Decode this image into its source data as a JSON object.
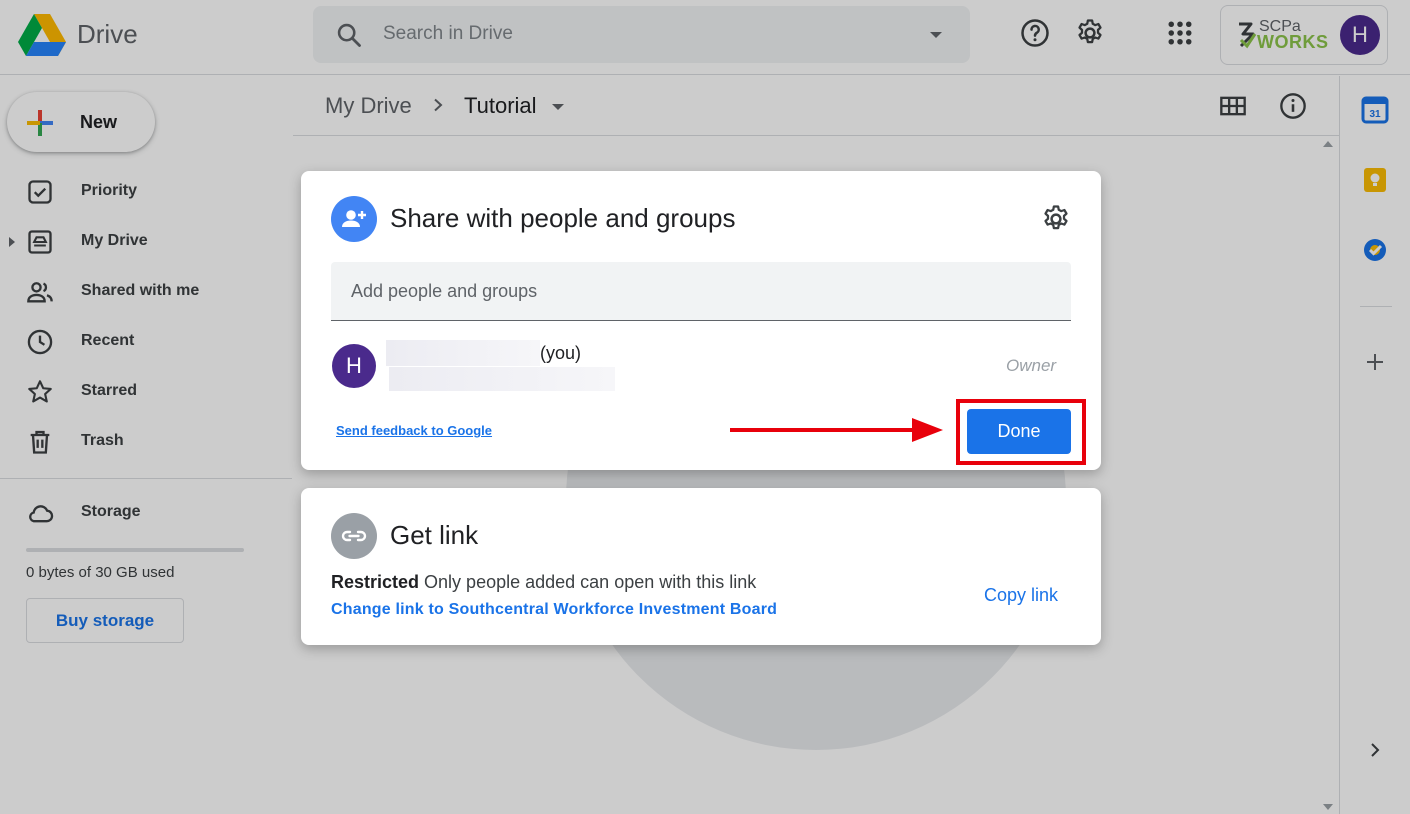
{
  "app": {
    "name": "Drive"
  },
  "search": {
    "placeholder": "Search in Drive"
  },
  "account": {
    "org_line1": "SCPa",
    "org_line2": "WORKS",
    "avatar_initial": "H"
  },
  "sidebar": {
    "new_label": "New",
    "items": [
      {
        "label": "Priority"
      },
      {
        "label": "My Drive"
      },
      {
        "label": "Shared with me"
      },
      {
        "label": "Recent"
      },
      {
        "label": "Starred"
      },
      {
        "label": "Trash"
      }
    ],
    "storage": {
      "label": "Storage",
      "used_text": "0 bytes of 30 GB used",
      "used_fraction": 0.0,
      "buy_label": "Buy storage"
    }
  },
  "breadcrumb": {
    "root": "My Drive",
    "current": "Tutorial"
  },
  "right_panel": {
    "calendar_day": "31"
  },
  "share_dialog": {
    "title": "Share with people and groups",
    "add_placeholder": "Add people and groups",
    "person": {
      "initial": "H",
      "suffix": "(you)",
      "role": "Owner"
    },
    "feedback_link": "Send feedback to Google",
    "done_label": "Done"
  },
  "link_dialog": {
    "title": "Get link",
    "restriction_bold": "Restricted",
    "restriction_text": "Only people added can open with this link",
    "change_link": "Change link to Southcentral Workforce Investment Board",
    "copy_link": "Copy link"
  },
  "colors": {
    "accent": "#1a73e8",
    "highlight": "#e8000b",
    "avatar": "#4a2a8c"
  }
}
